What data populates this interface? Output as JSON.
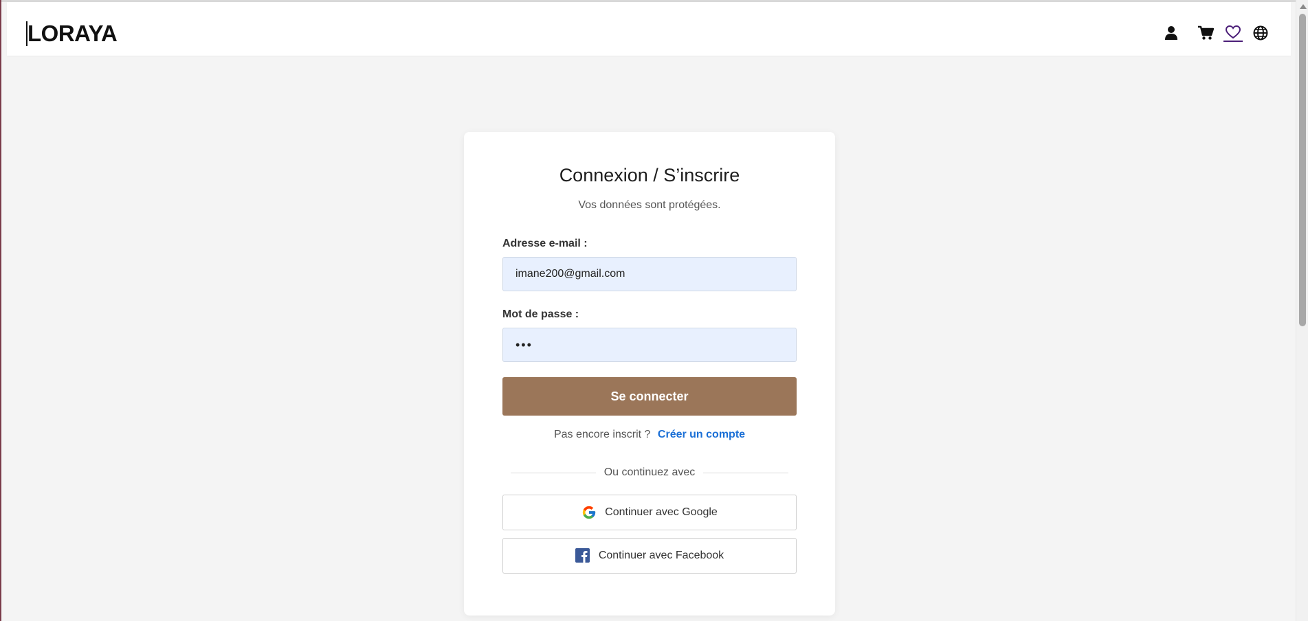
{
  "header": {
    "logo": "LORAYA",
    "icons": [
      "user-icon",
      "cart-icon",
      "heart-icon",
      "globe-icon"
    ]
  },
  "login": {
    "title": "Connexion / S’inscrire",
    "subtitle": "Vos données sont protégées.",
    "email_label": "Adresse e-mail :",
    "email_value": "imane200@gmail.com",
    "password_label": "Mot de passe :",
    "password_value": "•••",
    "submit_label": "Se connecter",
    "signup_prompt": "Pas encore inscrit ?",
    "signup_link": "Créer un compte",
    "divider_text": "Ou continuez avec",
    "google_label": "Continuer avec Google",
    "facebook_label": "Continuer avec Facebook"
  },
  "colors": {
    "primary_button": "#9b7659",
    "link": "#1a6fd6",
    "input_bg": "#e8f0fe",
    "facebook": "#3b5998"
  }
}
